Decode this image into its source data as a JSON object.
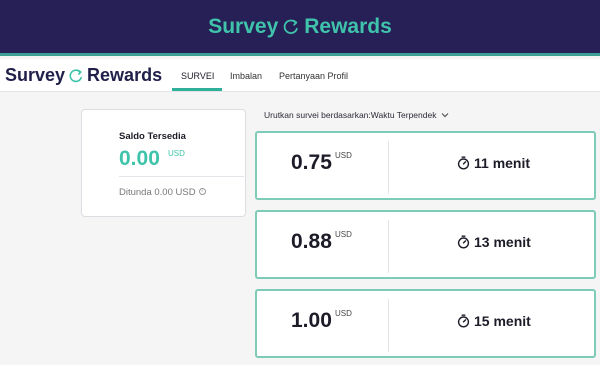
{
  "banner": {
    "brand_part1": "Survey",
    "brand_part2": "Rewards"
  },
  "nav": {
    "logo_part1": "Survey",
    "logo_part2": "Rewards",
    "tabs": [
      {
        "label": "SURVEI",
        "active": true
      },
      {
        "label": "Imbalan",
        "active": false
      },
      {
        "label": "Pertanyaan Profil",
        "active": false
      }
    ]
  },
  "balance": {
    "title": "Saldo Tersedia",
    "amount": "0.00",
    "amount_unit": "USD",
    "pending": "Ditunda 0.00 USD"
  },
  "sort": {
    "label": "Urutkan survei berdasarkan:",
    "value": "Waktu Terpendek"
  },
  "surveys": [
    {
      "price": "0.75",
      "unit": "USD",
      "duration": "11 menit"
    },
    {
      "price": "0.88",
      "unit": "USD",
      "duration": "13 menit"
    },
    {
      "price": "1.00",
      "unit": "USD",
      "duration": "15 menit"
    }
  ],
  "colors": {
    "banner_bg": "#262057",
    "accent": "#3fc3aa",
    "card_border": "#7ecbb8"
  }
}
